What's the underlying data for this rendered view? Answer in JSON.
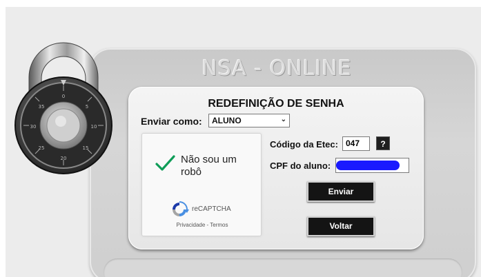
{
  "header": {
    "title": "NSA - ONLINE"
  },
  "form": {
    "title": "REDEFINIÇÃO DE SENHA",
    "send_as_label": "Enviar como:",
    "send_as_value": "ALUNO",
    "etec_code_label": "Código da Etec:",
    "etec_code_value": "047",
    "help_label": "?",
    "cpf_label": "CPF do aluno:",
    "send_label": "Enviar",
    "back_label": "Voltar"
  },
  "recaptcha": {
    "checkbox_text": "Não sou um robô",
    "brand": "reCAPTCHA",
    "links": "Privacidade - Termos"
  },
  "colors": {
    "button_bg": "#141414",
    "check_green": "#0f9d58",
    "redaction_blue": "#1a1aff"
  },
  "icons": {
    "logo": "padlock-icon",
    "check": "check-icon",
    "recaptcha": "recaptcha-logo-icon",
    "dropdown": "chevron-down-icon"
  }
}
